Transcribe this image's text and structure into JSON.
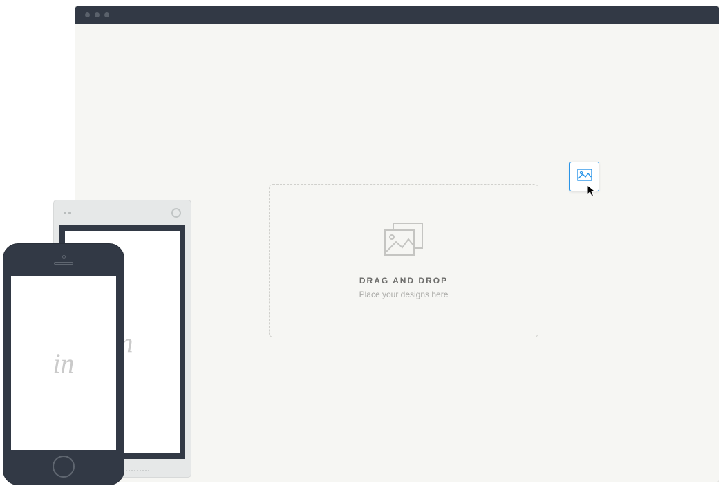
{
  "dropZone": {
    "title": "DRAG AND DROP",
    "subtitle": "Place your designs here"
  },
  "logo": {
    "text": "in"
  },
  "icons": {
    "dropImage": "image-stack-icon",
    "dragThumb": "image-icon",
    "cursor": "cursor-arrow-icon"
  }
}
